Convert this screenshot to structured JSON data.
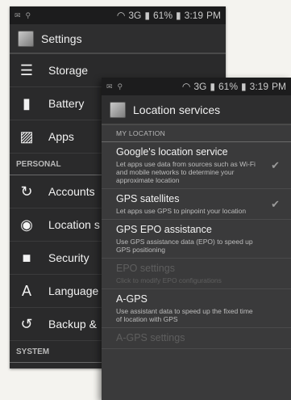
{
  "back": {
    "status": {
      "battery": "61%",
      "time": "3:19",
      "ampm": "PM",
      "network": "3G"
    },
    "title": "Settings",
    "items": [
      {
        "label": "Storage",
        "icon": "storage-icon"
      },
      {
        "label": "Battery",
        "icon": "battery-icon"
      },
      {
        "label": "Apps",
        "icon": "apps-icon"
      }
    ],
    "section_personal": "PERSONAL",
    "personal_items": [
      {
        "label": "Accounts",
        "icon": "sync-icon"
      },
      {
        "label": "Location s",
        "icon": "location-icon"
      },
      {
        "label": "Security",
        "icon": "lock-icon"
      },
      {
        "label": "Language",
        "icon": "language-icon"
      },
      {
        "label": "Backup &",
        "icon": "backup-icon"
      }
    ],
    "section_system": "SYSTEM"
  },
  "front": {
    "status": {
      "battery": "61%",
      "time": "3:19",
      "ampm": "PM",
      "network": "3G"
    },
    "title": "Location services",
    "section": "MY LOCATION",
    "items": [
      {
        "title": "Google's location service",
        "summary": "Let apps use data from sources such as Wi-Fi and mobile networks to determine your approximate location",
        "checked": true,
        "enabled": true
      },
      {
        "title": "GPS satellites",
        "summary": "Let apps use GPS to pinpoint your location",
        "checked": true,
        "enabled": true
      },
      {
        "title": "GPS EPO assistance",
        "summary": "Use GPS assistance data (EPO) to speed up GPS positioning",
        "checked": false,
        "enabled": true
      },
      {
        "title": "EPO settings",
        "summary": "Click to modify EPO configurations",
        "checked": false,
        "enabled": false
      },
      {
        "title": "A-GPS",
        "summary": "Use assistant data to speed up the fixed time of location with GPS",
        "checked": false,
        "enabled": true
      },
      {
        "title": "A-GPS settings",
        "summary": "",
        "checked": false,
        "enabled": false
      }
    ]
  }
}
